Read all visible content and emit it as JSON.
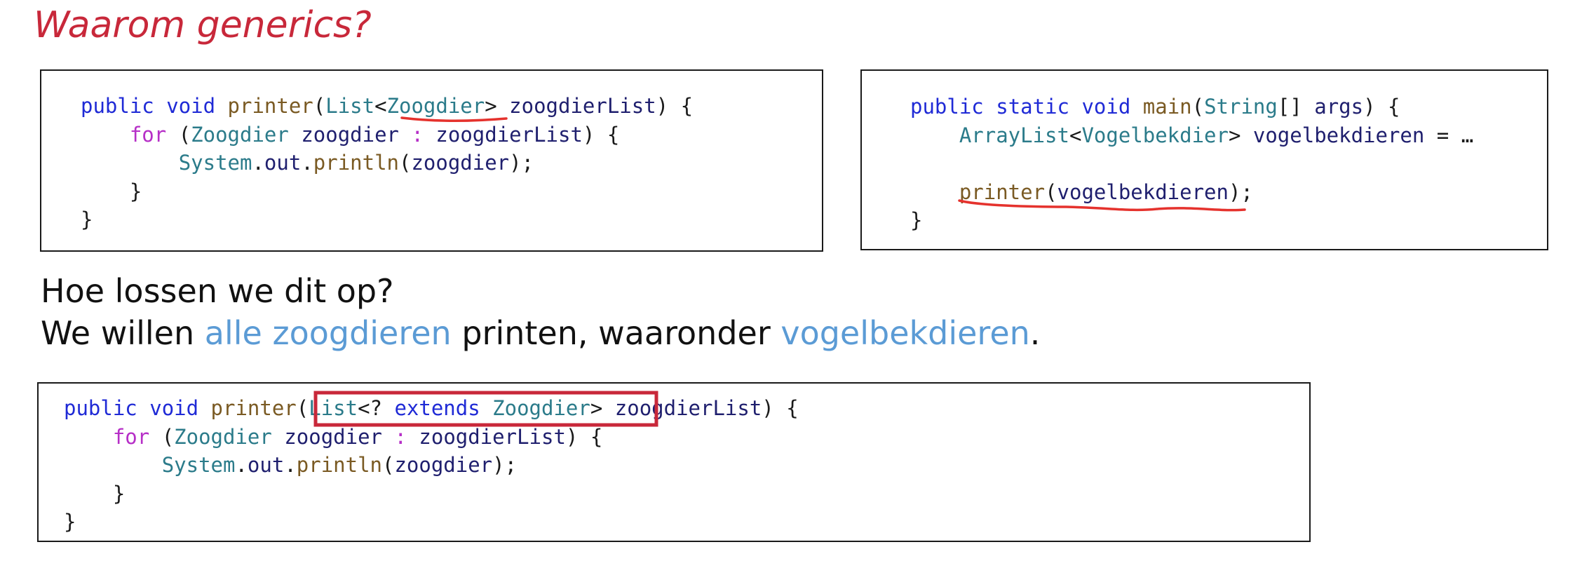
{
  "slide": {
    "title": "Waarom generics?",
    "question": "Hoe lossen we dit op?",
    "statement": {
      "part1": "We willen ",
      "highlight1": "alle zoogdieren",
      "part2": " printen, waaronder ",
      "highlight2": "vogelbekdieren",
      "part3": "."
    }
  },
  "code_top_left": {
    "line1": {
      "t1": "public",
      "t2": " ",
      "t3": "void",
      "t4": " ",
      "t5": "printer",
      "t6": "(",
      "t7": "List",
      "t8": "<",
      "t9": "Zoogdier",
      "t10": "> ",
      "t11": "zoogdierList",
      "t12": ") {"
    },
    "line2": {
      "t1": "    ",
      "t2": "for",
      "t3": " (",
      "t4": "Zoogdier",
      "t5": " ",
      "t6": "zoogdier",
      "t7": " ",
      "t8": ":",
      "t9": " ",
      "t10": "zoogdierList",
      "t11": ") {"
    },
    "line3": {
      "t1": "        ",
      "t2": "System",
      "t3": ".",
      "t4": "out",
      "t5": ".",
      "t6": "println",
      "t7": "(",
      "t8": "zoogdier",
      "t9": ");"
    },
    "line4": "    }",
    "line5": "}"
  },
  "code_top_right": {
    "line1": {
      "t1": "public",
      "t2": " ",
      "t3": "static",
      "t4": " ",
      "t5": "void",
      "t6": " ",
      "t7": "main",
      "t8": "(",
      "t9": "String",
      "t10": "[] ",
      "t11": "args",
      "t12": ") {"
    },
    "line2": {
      "t1": "    ",
      "t2": "ArrayList",
      "t3": "<",
      "t4": "Vogelbekdier",
      "t5": "> ",
      "t6": "vogelbekdieren",
      "t7": " = …"
    },
    "line3": "",
    "line4": {
      "t1": "    ",
      "t2": "printer",
      "t3": "(",
      "t4": "vogelbekdieren",
      "t5": ");"
    },
    "line5": "}"
  },
  "code_bottom": {
    "line1": {
      "t1": "public",
      "t2": " ",
      "t3": "void",
      "t4": " ",
      "t5": "printer",
      "t6": "(",
      "t7": "List",
      "t8": "<? ",
      "t9": "extends",
      "t10": " ",
      "t11": "Zoogdier",
      "t12": ">",
      "t13": " ",
      "t14": "zoogdierList",
      "t15": ") {"
    },
    "line2": {
      "t1": "    ",
      "t2": "for",
      "t3": " (",
      "t4": "Zoogdier",
      "t5": " ",
      "t6": "zoogdier",
      "t7": " ",
      "t8": ":",
      "t9": " ",
      "t10": "zoogdierList",
      "t11": ") {"
    },
    "line3": {
      "t1": "        ",
      "t2": "System",
      "t3": ".",
      "t4": "out",
      "t5": ".",
      "t6": "println",
      "t7": "(",
      "t8": "zoogdier",
      "t9": ");"
    },
    "line4": "    }",
    "line5": "}"
  },
  "colors": {
    "title": "#c8283a",
    "keyword": "#1f2ad6",
    "control": "#b62fc7",
    "method": "#7a5a23",
    "type": "#2b7b8a",
    "identifier": "#1f1f6e",
    "highlight": "#5b9bd5",
    "annotation": "#e5322d",
    "box_highlight": "#c8283a"
  }
}
